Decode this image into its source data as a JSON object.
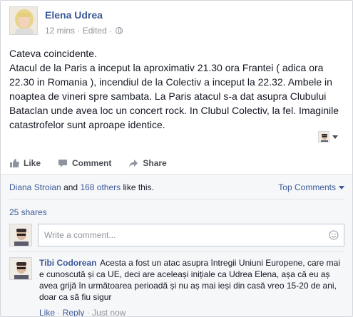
{
  "post": {
    "author": "Elena Udrea",
    "time": "12 mins",
    "edited": "Edited",
    "dot": "·",
    "lines": [
      "Cateva coincidente.",
      "Atacul de la Paris a inceput la aproximativ 21.30 ora Frantei ( adica ora 22.30 in Romania ), incendiul de la Colectiv a inceput la 22.32. Ambele in noaptea de vineri spre sambata. La Paris atacul s-a dat asupra Clubului Bataclan unde avea loc un concert rock. In Clubul Colectiv, la fel. Imaginile catastrofelor sunt aproape identice."
    ]
  },
  "actions": {
    "like": "Like",
    "comment": "Comment",
    "share": "Share"
  },
  "likes": {
    "name": "Diana Stroian",
    "and": "and",
    "others": "168 others",
    "suffix": "like this."
  },
  "top_comments": "Top Comments",
  "shares": "25 shares",
  "comment_box": {
    "placeholder": "Write a comment..."
  },
  "comment": {
    "author": "Tibi Codorean",
    "text": "Acesta a fost un atac asupra întregii Uniuni Europene, care mai e cunoscută și ca UE, deci are aceleași inițiale ca Udrea Elena, așa că eu aș avea grijă în următoarea perioadă și nu aș mai ieși din casă vreo 15-20 de ani, doar ca să fiu sigur",
    "like": "Like",
    "reply": "Reply",
    "time": "Just now",
    "sep": "·"
  },
  "colors": {
    "brand": "#3b5998",
    "muted": "#90949c",
    "text": "#141823"
  }
}
